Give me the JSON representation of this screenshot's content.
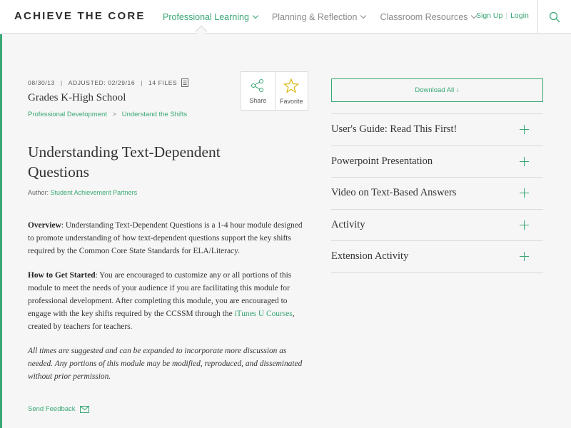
{
  "header": {
    "logo": "ACHIEVE THE CORE",
    "nav": [
      {
        "label": "Professional Learning",
        "active": true
      },
      {
        "label": "Planning & Reflection",
        "active": false
      },
      {
        "label": "Classroom Resources",
        "active": false
      }
    ],
    "sign_up": "Sign Up",
    "separator": "|",
    "login": "Login"
  },
  "meta": {
    "date": "08/30/13",
    "adjusted": "ADJUSTED: 02/29/16",
    "files": "14 FILES",
    "pipe": "|"
  },
  "grades": "Grades K-High School",
  "breadcrumbs": {
    "first": "Professional Development",
    "sep": ">",
    "second": "Understand the Shifts"
  },
  "actions": {
    "share": "Share",
    "favorite": "Favorite"
  },
  "title": "Understanding Text-Dependent Questions",
  "author": {
    "label": "Author:",
    "name": "Student Achievement Partners"
  },
  "overview": {
    "heading": "Overview",
    "text": ": Understanding Text-Dependent Questions is a 1-4 hour module designed to promote understanding of how text-dependent questions support the key shifts required by the Common Core State Standards for ELA/Literacy."
  },
  "getting_started": {
    "heading": "How to Get Started",
    "text": ": You are encouraged to customize any or all portions of this module to meet the needs of your audience if you are facilitating this module for professional development.  After completing this module, you are encouraged to engage with the key shifts required by the CCSSM through the ",
    "link": "iTunes U Courses",
    "text_after": ", created by teachers for teachers."
  },
  "disclaimer": "All times are suggested and can be expanded to incorporate more discussion as needed. Any portions of this module may be modified, reproduced, and disseminated without prior permission.",
  "feedback": "Send Feedback",
  "download_all": "Download All ↓",
  "files": [
    "User's Guide: Read This First!",
    "Powerpoint Presentation",
    "Video on Text-Based Answers",
    "Activity",
    "Extension Activity"
  ],
  "colors": {
    "accent": "#3aa775",
    "border": "#d9dcda",
    "background": "#f5f6f5"
  }
}
